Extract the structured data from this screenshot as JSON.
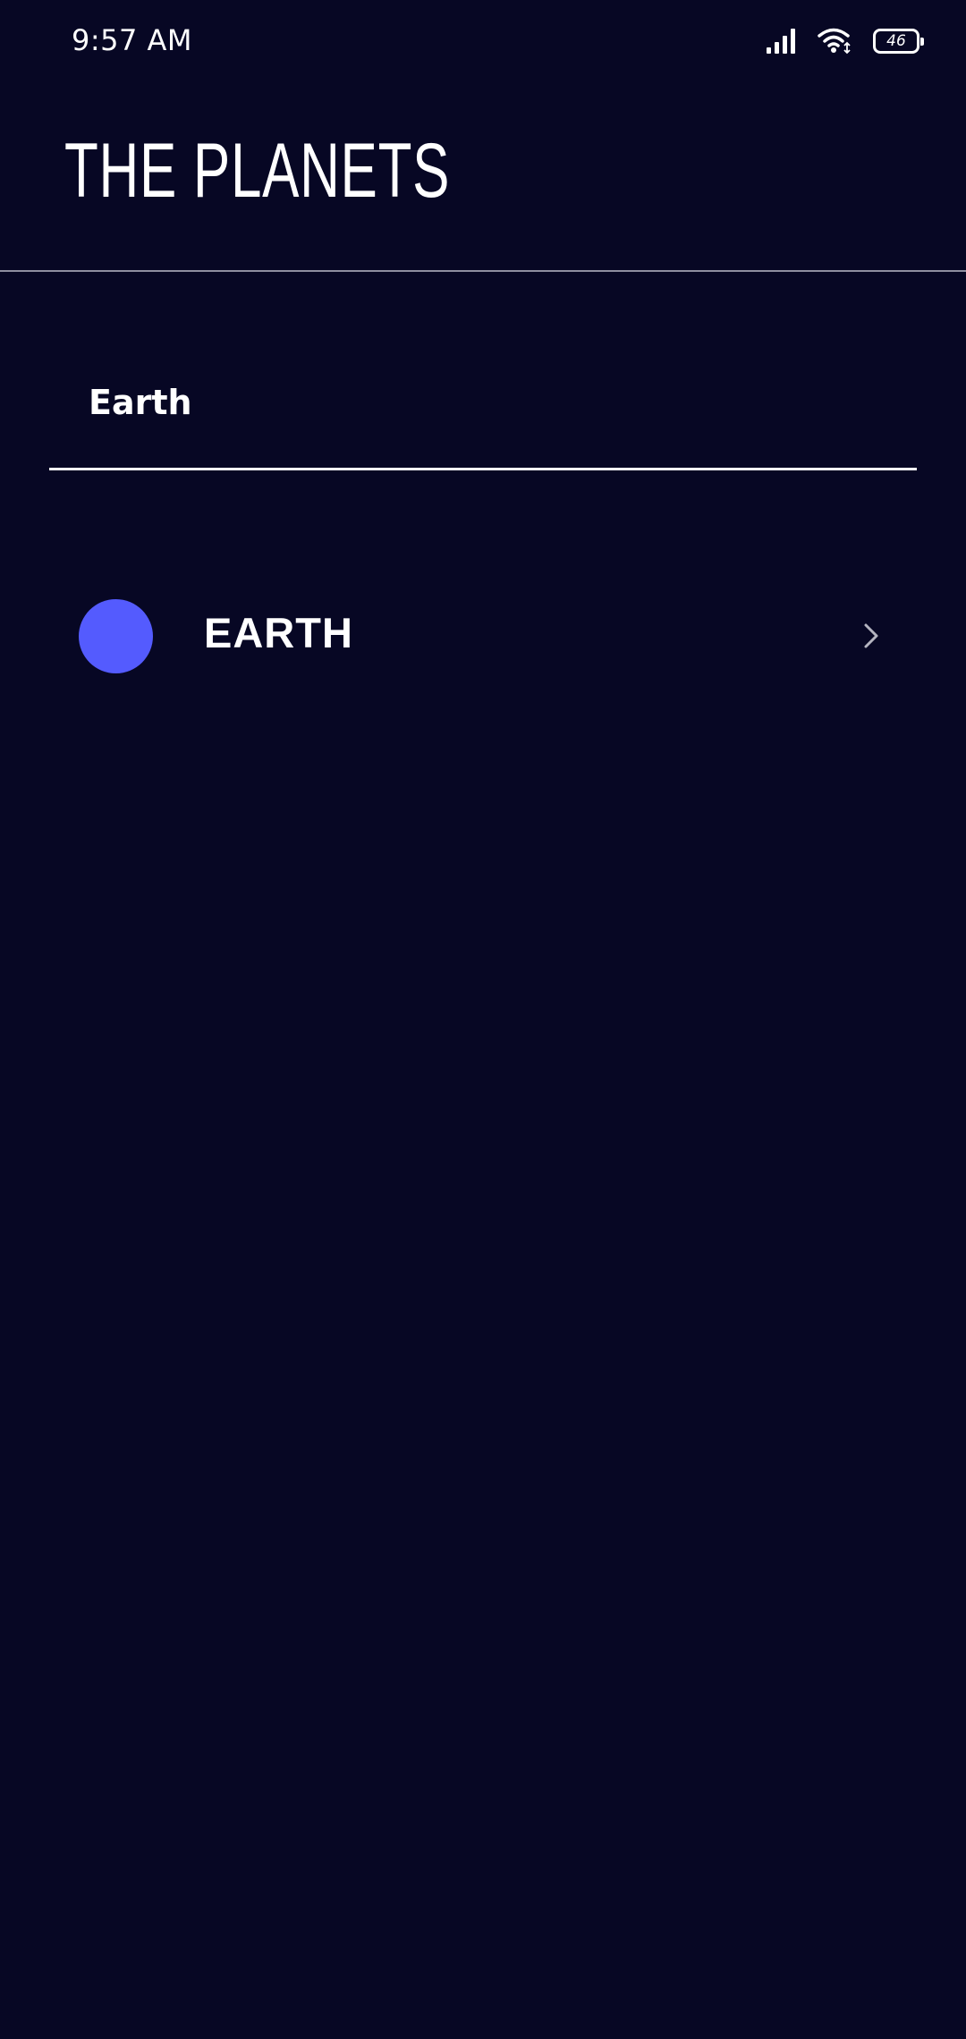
{
  "status_bar": {
    "time": "9:57 AM",
    "battery_level": "46",
    "icons": [
      "signal-icon",
      "wifi-icon",
      "battery-icon"
    ]
  },
  "header": {
    "title": "THE PLANETS"
  },
  "search": {
    "value": "Earth",
    "placeholder": ""
  },
  "planets": [
    {
      "name": "EARTH",
      "color": "#545bfe",
      "icon": "chevron-right-icon"
    }
  ],
  "colors": {
    "background": "#070724",
    "divider": "#8e8ea0",
    "text": "#ffffff"
  }
}
